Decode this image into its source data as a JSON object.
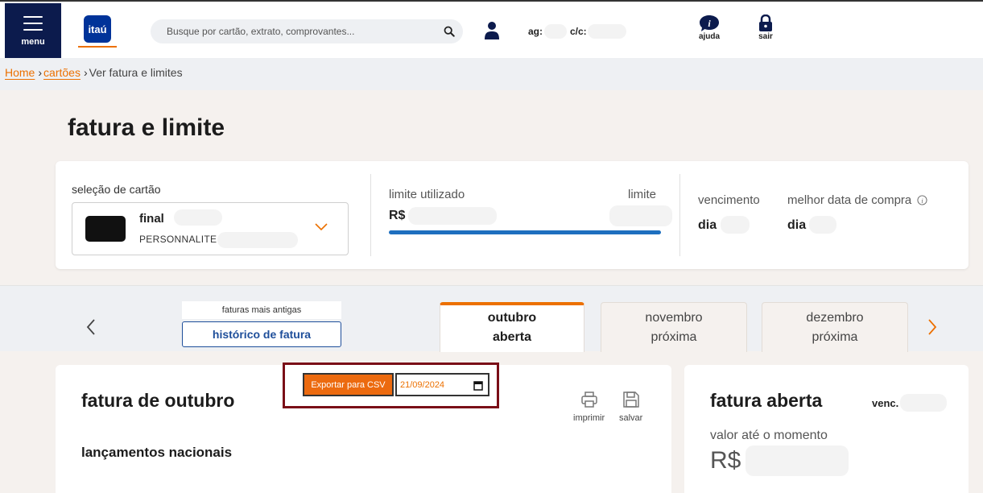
{
  "header": {
    "menu_label": "menu",
    "logo_text": "itaú",
    "search_placeholder": "Busque por cartão, extrato, comprovantes...",
    "agency_label": "ag:",
    "account_label": "c/c:",
    "help_label": "ajuda",
    "exit_label": "sair"
  },
  "breadcrumb": {
    "home": "Home",
    "cards": "cartões",
    "current": "Ver fatura e limites"
  },
  "page_title": "fatura e limite",
  "card_summary": {
    "select_label": "seleção de cartão",
    "card_final": "final",
    "card_type": "PERSONNALITE",
    "limit_used_label": "limite utilizado",
    "limit_label": "limite",
    "limit_currency": "R$",
    "limit_used_fraction": 1.0,
    "due_label": "vencimento",
    "due_value": "dia",
    "best_date_label": "melhor data de compra",
    "best_date_value": "dia"
  },
  "tabs": {
    "older_caption": "faturas mais antigas",
    "history_button": "histórico de fatura",
    "items": [
      {
        "month": "outubro",
        "status": "aberta"
      },
      {
        "month": "novembro",
        "status": "próxima"
      },
      {
        "month": "dezembro",
        "status": "próxima"
      }
    ]
  },
  "invoice": {
    "title": "fatura de outubro",
    "section": "lançamentos nacionais",
    "print_label": "imprimir",
    "save_label": "salvar",
    "export_button": "Exportar para CSV",
    "export_date": "21/09/2024"
  },
  "open_invoice": {
    "title": "fatura aberta",
    "due": "venc.",
    "value_label": "valor até o momento",
    "currency": "R$"
  },
  "colors": {
    "brand_orange": "#ec7000",
    "brand_blue": "#003399",
    "menu_navy": "#0c1b4d",
    "limit_bar": "#1e6fbf",
    "highlight_border": "#7a0e17"
  }
}
